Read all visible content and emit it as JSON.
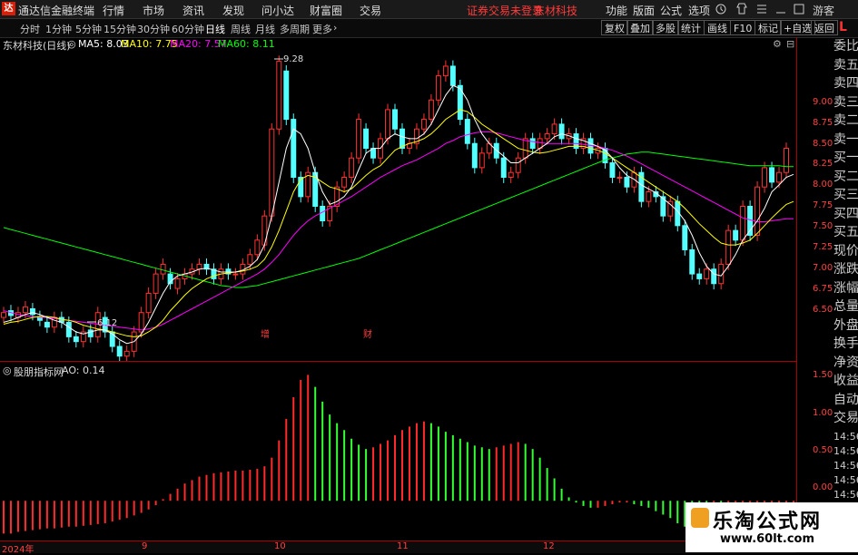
{
  "menu": {
    "logo": "达",
    "app_title": "通达信金融终端",
    "items": [
      "行情",
      "市场",
      "资讯",
      "发现",
      "问小达",
      "财富圈",
      "交易"
    ],
    "notice": "证券交易未登录",
    "stock": "东材科技",
    "right": [
      "功能",
      "版面",
      "公式",
      "选项"
    ],
    "guest": "游客"
  },
  "periods": [
    "分时",
    "1分钟",
    "5分钟",
    "15分钟",
    "30分钟",
    "60分钟",
    "日线",
    "周线",
    "月线",
    "多周期",
    "更多"
  ],
  "active_period": "日线",
  "right_tools": [
    "复权",
    "叠加",
    "多股",
    "统计",
    "画线",
    "F10",
    "标记",
    "+自选",
    "返回"
  ],
  "legend": {
    "title": "东材科技(日线)",
    "ma5": "MA5: 8.03",
    "ma10": "MA10: 7.75",
    "ma20": "MA20: 7.57",
    "ma60": "MA60: 8.11",
    "colors": {
      "ma5": "#ffffff",
      "ma10": "#ffff00",
      "ma20": "#ff00ff",
      "ma60": "#00ff00"
    }
  },
  "indicator": {
    "title": "股朋指标网",
    "value": "AO: 0.14"
  },
  "annotations": {
    "high": "9.28",
    "low": "6.12",
    "mark1": "增",
    "mark2": "财"
  },
  "right_panel": [
    "委比",
    "卖五",
    "卖四",
    "卖三",
    "卖二",
    "卖一",
    "买一",
    "买二",
    "买三",
    "买四",
    "买五",
    "现价",
    "涨跌",
    "涨幅",
    "总量",
    "外盘",
    "换手",
    "净资",
    "收益",
    "自动",
    "交易",
    "14:56",
    "14:56",
    "14:56",
    "14:56",
    "14:56",
    "14:56",
    "14:56"
  ],
  "date_labels": [
    "2024年",
    "9",
    "10",
    "11",
    "12"
  ],
  "watermark": {
    "title": "乐淘公式网",
    "url": "www.60lt.com"
  },
  "chart_data": {
    "type": "candlestick",
    "price_axis": {
      "ticks": [
        9.0,
        8.75,
        8.5,
        8.25,
        8.0,
        7.75,
        7.5,
        7.25,
        7.0,
        6.75,
        6.5
      ],
      "ylim": [
        6.1,
        9.45
      ]
    },
    "indicator_axis": {
      "ticks": [
        1.5,
        1.0,
        0.5,
        0.0
      ],
      "ylim": [
        -0.46,
        1.6
      ]
    },
    "candles": [
      {
        "o": 6.55,
        "c": 6.6
      },
      {
        "o": 6.62,
        "c": 6.57
      },
      {
        "o": 6.55,
        "c": 6.6
      },
      {
        "o": 6.6,
        "c": 6.66
      },
      {
        "o": 6.64,
        "c": 6.58
      },
      {
        "o": 6.56,
        "c": 6.52
      },
      {
        "o": 6.5,
        "c": 6.45
      },
      {
        "o": 6.45,
        "c": 6.55
      },
      {
        "o": 6.55,
        "c": 6.5
      },
      {
        "o": 6.5,
        "c": 6.35
      },
      {
        "o": 6.35,
        "c": 6.3
      },
      {
        "o": 6.3,
        "c": 6.4
      },
      {
        "o": 6.42,
        "c": 6.35
      },
      {
        "o": 6.35,
        "c": 6.6
      },
      {
        "o": 6.55,
        "c": 6.4
      },
      {
        "o": 6.4,
        "c": 6.25
      },
      {
        "o": 6.25,
        "c": 6.15
      },
      {
        "o": 6.15,
        "c": 6.2
      },
      {
        "o": 6.2,
        "c": 6.4
      },
      {
        "o": 6.4,
        "c": 6.6
      },
      {
        "o": 6.6,
        "c": 6.8
      },
      {
        "o": 6.8,
        "c": 7.0
      },
      {
        "o": 7.0,
        "c": 7.1
      },
      {
        "o": 7.0,
        "c": 6.9
      },
      {
        "o": 6.85,
        "c": 6.95
      },
      {
        "o": 6.95,
        "c": 7.0
      },
      {
        "o": 7.0,
        "c": 7.05
      },
      {
        "o": 7.05,
        "c": 7.1
      },
      {
        "o": 7.1,
        "c": 7.05
      },
      {
        "o": 7.05,
        "c": 6.95
      },
      {
        "o": 6.95,
        "c": 7.05
      },
      {
        "o": 7.05,
        "c": 7.0
      },
      {
        "o": 7.0,
        "c": 7.0
      },
      {
        "o": 7.0,
        "c": 7.1
      },
      {
        "o": 7.1,
        "c": 7.2
      },
      {
        "o": 7.2,
        "c": 7.35
      },
      {
        "o": 7.3,
        "c": 7.6
      },
      {
        "o": 7.6,
        "c": 8.5
      },
      {
        "o": 8.5,
        "c": 9.2
      },
      {
        "o": 9.1,
        "c": 8.6
      },
      {
        "o": 8.6,
        "c": 8.0
      },
      {
        "o": 8.0,
        "c": 7.8
      },
      {
        "o": 7.8,
        "c": 8.05
      },
      {
        "o": 8.05,
        "c": 7.7
      },
      {
        "o": 7.7,
        "c": 7.55
      },
      {
        "o": 7.55,
        "c": 7.7
      },
      {
        "o": 7.7,
        "c": 7.9
      },
      {
        "o": 7.9,
        "c": 8.0
      },
      {
        "o": 8.0,
        "c": 8.2
      },
      {
        "o": 8.2,
        "c": 8.6
      },
      {
        "o": 8.5,
        "c": 8.3
      },
      {
        "o": 8.3,
        "c": 8.2
      },
      {
        "o": 8.2,
        "c": 8.4
      },
      {
        "o": 8.4,
        "c": 8.7
      },
      {
        "o": 8.7,
        "c": 8.5
      },
      {
        "o": 8.5,
        "c": 8.3
      },
      {
        "o": 8.3,
        "c": 8.35
      },
      {
        "o": 8.35,
        "c": 8.5
      },
      {
        "o": 8.5,
        "c": 8.6
      },
      {
        "o": 8.6,
        "c": 8.8
      },
      {
        "o": 8.8,
        "c": 9.05
      },
      {
        "o": 9.05,
        "c": 9.15
      },
      {
        "o": 9.15,
        "c": 8.95
      },
      {
        "o": 8.95,
        "c": 8.6
      },
      {
        "o": 8.6,
        "c": 8.35
      },
      {
        "o": 8.35,
        "c": 8.1
      },
      {
        "o": 8.1,
        "c": 8.25
      },
      {
        "o": 8.25,
        "c": 8.35
      },
      {
        "o": 8.35,
        "c": 8.2
      },
      {
        "o": 8.2,
        "c": 8.0
      },
      {
        "o": 8.0,
        "c": 8.05
      },
      {
        "o": 8.05,
        "c": 8.2
      },
      {
        "o": 8.2,
        "c": 8.4
      },
      {
        "o": 8.4,
        "c": 8.3
      },
      {
        "o": 8.3,
        "c": 8.4
      },
      {
        "o": 8.4,
        "c": 8.45
      },
      {
        "o": 8.45,
        "c": 8.55
      },
      {
        "o": 8.55,
        "c": 8.4
      },
      {
        "o": 8.4,
        "c": 8.45
      },
      {
        "o": 8.45,
        "c": 8.3
      },
      {
        "o": 8.3,
        "c": 8.4
      },
      {
        "o": 8.4,
        "c": 8.25
      },
      {
        "o": 8.25,
        "c": 8.3
      },
      {
        "o": 8.3,
        "c": 8.15
      },
      {
        "o": 8.15,
        "c": 8.0
      },
      {
        "o": 8.0,
        "c": 8.0
      },
      {
        "o": 8.0,
        "c": 7.9
      },
      {
        "o": 7.9,
        "c": 8.05
      },
      {
        "o": 8.05,
        "c": 7.75
      },
      {
        "o": 7.75,
        "c": 7.85
      },
      {
        "o": 7.85,
        "c": 7.8
      },
      {
        "o": 7.8,
        "c": 7.6
      },
      {
        "o": 7.6,
        "c": 7.75
      },
      {
        "o": 7.75,
        "c": 7.5
      },
      {
        "o": 7.5,
        "c": 7.25
      },
      {
        "o": 7.25,
        "c": 7.0
      },
      {
        "o": 7.0,
        "c": 6.95
      },
      {
        "o": 6.95,
        "c": 7.05
      },
      {
        "o": 7.05,
        "c": 6.9
      },
      {
        "o": 6.9,
        "c": 7.1
      },
      {
        "o": 7.1,
        "c": 7.45
      },
      {
        "o": 7.45,
        "c": 7.35
      },
      {
        "o": 7.35,
        "c": 7.7
      },
      {
        "o": 7.7,
        "c": 7.4
      },
      {
        "o": 7.4,
        "c": 7.9
      },
      {
        "o": 7.9,
        "c": 8.1
      },
      {
        "o": 8.1,
        "c": 7.95
      },
      {
        "o": 7.95,
        "c": 8.05
      },
      {
        "o": 8.05,
        "c": 8.3
      }
    ],
    "ma5": [
      6.5,
      6.52,
      6.55,
      6.58,
      6.6,
      6.58,
      6.55,
      6.52,
      6.5,
      6.45,
      6.4,
      6.38,
      6.4,
      6.42,
      6.42,
      6.38,
      6.32,
      6.28,
      6.3,
      6.38,
      6.5,
      6.65,
      6.8,
      6.92,
      6.98,
      7.0,
      7.02,
      7.05,
      7.06,
      7.04,
      7.02,
      7.02,
      7.02,
      7.04,
      7.08,
      7.15,
      7.3,
      7.6,
      7.95,
      8.3,
      8.5,
      8.45,
      8.3,
      8.05,
      7.85,
      7.72,
      7.75,
      7.8,
      7.9,
      8.08,
      8.25,
      8.3,
      8.3,
      8.4,
      8.45,
      8.42,
      8.4,
      8.4,
      8.45,
      8.55,
      8.7,
      8.85,
      8.95,
      8.92,
      8.8,
      8.6,
      8.45,
      8.35,
      8.28,
      8.22,
      8.15,
      8.15,
      8.2,
      8.25,
      8.3,
      8.35,
      8.42,
      8.45,
      8.43,
      8.4,
      8.38,
      8.35,
      8.32,
      8.28,
      8.2,
      8.1,
      8.02,
      7.98,
      7.92,
      7.88,
      7.84,
      7.78,
      7.72,
      7.65,
      7.55,
      7.4,
      7.22,
      7.08,
      7.0,
      6.98,
      7.08,
      7.2,
      7.35,
      7.45,
      7.55,
      7.68,
      7.85,
      7.92,
      8.0,
      8.03
    ],
    "ma10": [
      6.48,
      6.5,
      6.51,
      6.53,
      6.55,
      6.56,
      6.56,
      6.55,
      6.53,
      6.52,
      6.5,
      6.47,
      6.45,
      6.43,
      6.42,
      6.4,
      6.38,
      6.36,
      6.35,
      6.36,
      6.4,
      6.45,
      6.52,
      6.62,
      6.7,
      6.78,
      6.85,
      6.9,
      6.95,
      6.98,
      7.0,
      7.01,
      7.02,
      7.03,
      7.05,
      7.08,
      7.15,
      7.28,
      7.45,
      7.65,
      7.85,
      7.98,
      8.02,
      8.0,
      7.95,
      7.9,
      7.88,
      7.85,
      7.88,
      7.95,
      8.02,
      8.08,
      8.12,
      8.2,
      8.28,
      8.32,
      8.35,
      8.37,
      8.4,
      8.45,
      8.52,
      8.6,
      8.65,
      8.7,
      8.68,
      8.62,
      8.55,
      8.5,
      8.45,
      8.4,
      8.35,
      8.3,
      8.28,
      8.26,
      8.25,
      8.26,
      8.28,
      8.3,
      8.32,
      8.32,
      8.32,
      8.3,
      8.28,
      8.25,
      8.2,
      8.15,
      8.1,
      8.05,
      8.0,
      7.95,
      7.9,
      7.85,
      7.8,
      7.75,
      7.68,
      7.6,
      7.52,
      7.45,
      7.38,
      7.32,
      7.3,
      7.3,
      7.32,
      7.35,
      7.42,
      7.5,
      7.58,
      7.65,
      7.72,
      7.75
    ],
    "ma20": [
      6.62,
      6.6,
      6.58,
      6.57,
      6.56,
      6.55,
      6.55,
      6.54,
      6.53,
      6.52,
      6.51,
      6.5,
      6.49,
      6.48,
      6.47,
      6.46,
      6.45,
      6.44,
      6.43,
      6.42,
      6.43,
      6.45,
      6.48,
      6.52,
      6.56,
      6.6,
      6.64,
      6.68,
      6.72,
      6.76,
      6.8,
      6.84,
      6.88,
      6.92,
      6.96,
      7.0,
      7.05,
      7.12,
      7.2,
      7.3,
      7.4,
      7.48,
      7.55,
      7.6,
      7.64,
      7.68,
      7.72,
      7.76,
      7.8,
      7.85,
      7.9,
      7.95,
      8.0,
      8.04,
      8.08,
      8.12,
      8.15,
      8.18,
      8.22,
      8.26,
      8.3,
      8.35,
      8.38,
      8.42,
      8.44,
      8.46,
      8.47,
      8.47,
      8.46,
      8.44,
      8.42,
      8.4,
      8.38,
      8.37,
      8.36,
      8.35,
      8.35,
      8.35,
      8.35,
      8.35,
      8.34,
      8.33,
      8.32,
      8.3,
      8.28,
      8.25,
      8.22,
      8.18,
      8.14,
      8.1,
      8.06,
      8.02,
      7.98,
      7.94,
      7.9,
      7.86,
      7.82,
      7.78,
      7.74,
      7.7,
      7.66,
      7.62,
      7.58,
      7.56,
      7.54,
      7.54,
      7.55,
      7.56,
      7.57,
      7.57
    ],
    "ma60": [
      7.48,
      7.46,
      7.44,
      7.42,
      7.4,
      7.38,
      7.36,
      7.34,
      7.32,
      7.3,
      7.28,
      7.26,
      7.24,
      7.22,
      7.2,
      7.18,
      7.16,
      7.14,
      7.12,
      7.1,
      7.08,
      7.06,
      7.04,
      7.02,
      7.0,
      6.98,
      6.96,
      6.94,
      6.92,
      6.9,
      6.88,
      6.87,
      6.86,
      6.86,
      6.87,
      6.88,
      6.9,
      6.92,
      6.94,
      6.96,
      6.98,
      7.0,
      7.02,
      7.04,
      7.06,
      7.08,
      7.1,
      7.12,
      7.14,
      7.16,
      7.19,
      7.22,
      7.25,
      7.28,
      7.31,
      7.34,
      7.37,
      7.4,
      7.43,
      7.46,
      7.49,
      7.52,
      7.55,
      7.58,
      7.61,
      7.64,
      7.67,
      7.7,
      7.73,
      7.76,
      7.79,
      7.82,
      7.85,
      7.88,
      7.91,
      7.94,
      7.97,
      8.0,
      8.03,
      8.06,
      8.09,
      8.12,
      8.15,
      8.18,
      8.2,
      8.22,
      8.24,
      8.25,
      8.26,
      8.26,
      8.25,
      8.24,
      8.23,
      8.22,
      8.21,
      8.2,
      8.19,
      8.18,
      8.17,
      8.16,
      8.15,
      8.14,
      8.13,
      8.12,
      8.12,
      8.12,
      8.12,
      8.12,
      8.11,
      8.11
    ],
    "ao": [
      -0.38,
      -0.38,
      -0.36,
      -0.35,
      -0.34,
      -0.33,
      -0.32,
      -0.32,
      -0.31,
      -0.3,
      -0.3,
      -0.29,
      -0.28,
      -0.27,
      -0.26,
      -0.24,
      -0.22,
      -0.2,
      -0.17,
      -0.14,
      -0.1,
      -0.05,
      0.02,
      0.08,
      0.14,
      0.2,
      0.24,
      0.28,
      0.3,
      0.32,
      0.33,
      0.34,
      0.35,
      0.35,
      0.36,
      0.37,
      0.4,
      0.5,
      0.7,
      0.95,
      1.2,
      1.4,
      1.46,
      1.32,
      1.15,
      1.0,
      0.9,
      0.82,
      0.72,
      0.65,
      0.6,
      0.62,
      0.66,
      0.7,
      0.76,
      0.82,
      0.86,
      0.9,
      0.92,
      0.9,
      0.86,
      0.8,
      0.76,
      0.72,
      0.68,
      0.64,
      0.62,
      0.6,
      0.62,
      0.64,
      0.66,
      0.68,
      0.66,
      0.6,
      0.5,
      0.38,
      0.26,
      0.14,
      0.04,
      -0.02,
      -0.06,
      -0.08,
      -0.08,
      -0.06,
      -0.04,
      -0.02,
      -0.02,
      -0.04,
      -0.06,
      -0.08,
      -0.12,
      -0.16,
      -0.2,
      -0.26,
      -0.3,
      -0.34,
      -0.38,
      -0.42,
      -0.42,
      -0.44,
      -0.44,
      -0.44,
      -0.42,
      -0.4,
      -0.38,
      -0.36,
      -0.33,
      -0.3,
      -0.26,
      -0.22,
      -0.18,
      -0.14,
      -0.1,
      -0.05,
      0.02,
      0.14
    ]
  }
}
